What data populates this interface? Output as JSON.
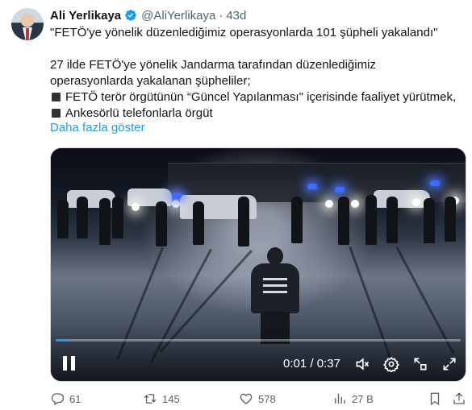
{
  "tweet": {
    "author_name": "Ali Yerlikaya",
    "handle": "@AliYerlikaya",
    "separator": "·",
    "time": "43d",
    "lines": [
      "\"FETÖ'ye yönelik düzenlediğimiz operasyonlarda 101 şüpheli yakalandı\"",
      "27 ilde FETÖ'ye yönelik Jandarma tarafından düzenlediğimiz",
      "operasyonlarda yakalanan şüpheliler;",
      "FETÖ terör örgütünün “Güncel Yapılanması\" içerisinde faaliyet yürütmek,",
      "Ankesörlü telefonlarla örgüt"
    ],
    "show_more": "Daha fazla göster"
  },
  "video": {
    "time_display": "0:01 / 0:37",
    "progress": 0.027
  },
  "actions": {
    "replies": "61",
    "reposts": "145",
    "likes": "578",
    "views": "27 B"
  },
  "colors": {
    "accent": "#1d9bf0",
    "muted": "#536471",
    "text": "#0f1419"
  },
  "icons": [
    "verified-badge-icon",
    "pause-icon",
    "mute-icon",
    "settings-icon",
    "pip-icon",
    "fullscreen-icon",
    "reply-icon",
    "repost-icon",
    "like-icon",
    "views-icon",
    "bookmark-icon",
    "share-icon"
  ]
}
